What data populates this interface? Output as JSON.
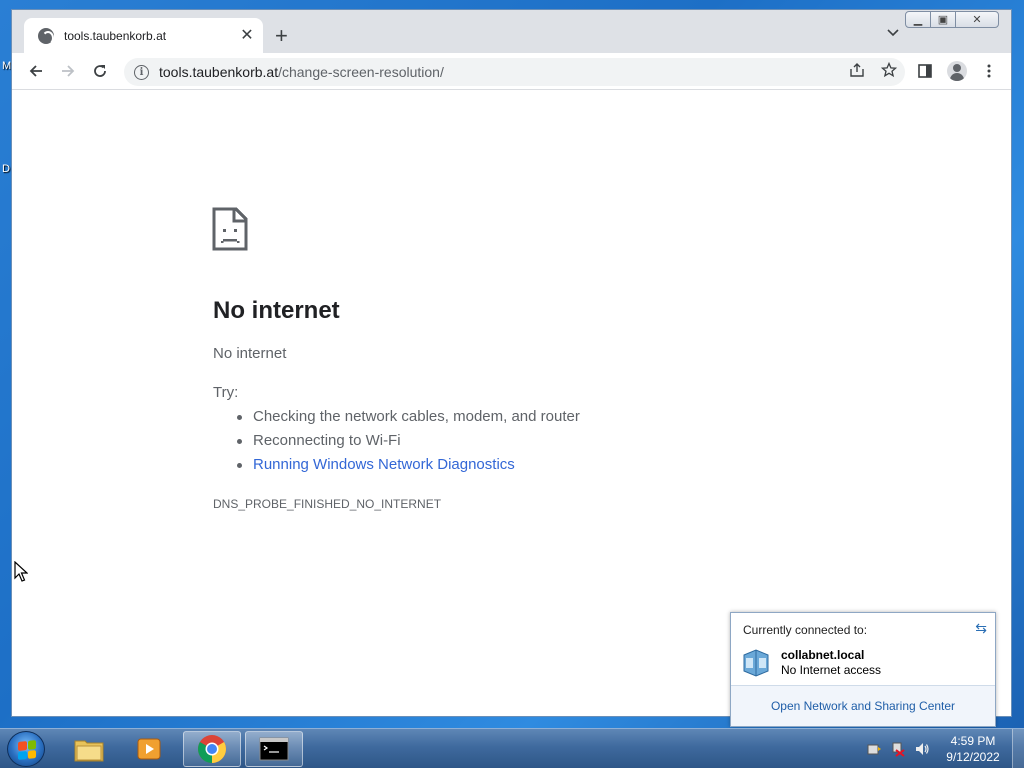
{
  "browser": {
    "tab_title": "tools.taubenkorb.at",
    "url_host": "tools.taubenkorb.at",
    "url_path": "/change-screen-resolution/"
  },
  "error_page": {
    "title": "No internet",
    "subtitle": "No internet",
    "try_label": "Try:",
    "suggestions": [
      "Checking the network cables, modem, and router",
      "Reconnecting to Wi-Fi",
      "Running Windows Network Diagnostics"
    ],
    "error_code": "DNS_PROBE_FINISHED_NO_INTERNET"
  },
  "network_flyout": {
    "header": "Currently connected to:",
    "network_name": "collabnet.local",
    "network_status": "No Internet access",
    "footer_link": "Open Network and Sharing Center"
  },
  "taskbar": {
    "time": "4:59 PM",
    "date": "9/12/2022"
  },
  "desktop": {
    "icon_fragment_1": "M",
    "icon_fragment_2": "D"
  },
  "colors": {
    "link": "#3367d6",
    "text_secondary": "#5f6368",
    "flyout_link": "#1f5ea8"
  }
}
